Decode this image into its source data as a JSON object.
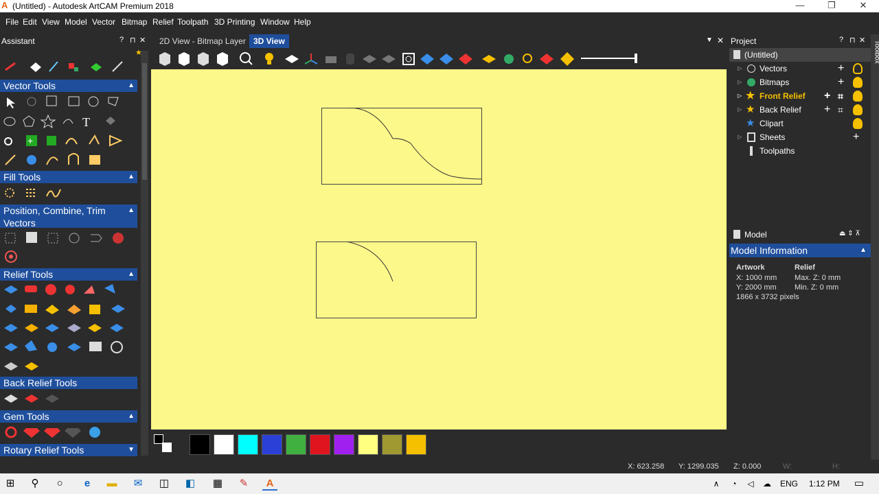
{
  "app": {
    "title": "(Untitled) - Autodesk ArtCAM Premium 2018",
    "logo_letter": "A",
    "controls": [
      "—",
      "❐",
      "✕"
    ]
  },
  "menu": [
    "File",
    "Edit",
    "View",
    "Model",
    "Vector",
    "Bitmap",
    "Relief",
    "Toolpath",
    "3D Printing",
    "Window",
    "Help"
  ],
  "assistant": {
    "title": "Assistant",
    "header_icons": [
      "?",
      "⊓",
      "✕"
    ],
    "sections": [
      "Vector Tools",
      "Fill Tools",
      "Position, Combine, Trim Vectors",
      "Relief Tools",
      "Back Relief Tools",
      "Gem Tools",
      "Rotary Relief Tools"
    ]
  },
  "view_tabs": [
    "2D View - Bitmap Layer",
    "3D View"
  ],
  "view_tab_icons": [
    "▼",
    "✕"
  ],
  "palette_colors": [
    "#000000",
    "#ffffff",
    "#00ffff",
    "#2b40d6",
    "#40b040",
    "#e0141e",
    "#a020f0",
    "#ffff80",
    "#a09830",
    "#f5c000"
  ],
  "project": {
    "title": "Project",
    "header_icons": [
      "?",
      "⊓",
      "✕"
    ],
    "items": [
      {
        "label": "(Untitled)",
        "bold": false
      },
      {
        "label": "Vectors",
        "bold": false
      },
      {
        "label": "Bitmaps",
        "bold": false
      },
      {
        "label": "Front Relief",
        "bold": true
      },
      {
        "label": "Back Relief",
        "bold": false
      },
      {
        "label": "Clipart",
        "bold": false
      },
      {
        "label": "Sheets",
        "bold": false
      },
      {
        "label": "Toolpaths",
        "bold": false
      }
    ]
  },
  "model": {
    "tab": "Model",
    "section": "Model Information",
    "artwork_label": "Artwork",
    "relief_label": "Relief",
    "x": "X: 1000 mm",
    "y": "Y: 2000 mm",
    "pixels": "1866 x 3732 pixels",
    "max_z": "Max. Z: 0 mm",
    "min_z": "Min. Z: 0 mm"
  },
  "status": {
    "x": "X: 623.258",
    "y": "Y: 1299.035",
    "z": "Z: 0.000",
    "w": "W:",
    "h": "H:"
  },
  "toolbox_label": "Toolbox",
  "taskbar": {
    "lang": "ENG",
    "time": "1:12 PM"
  }
}
